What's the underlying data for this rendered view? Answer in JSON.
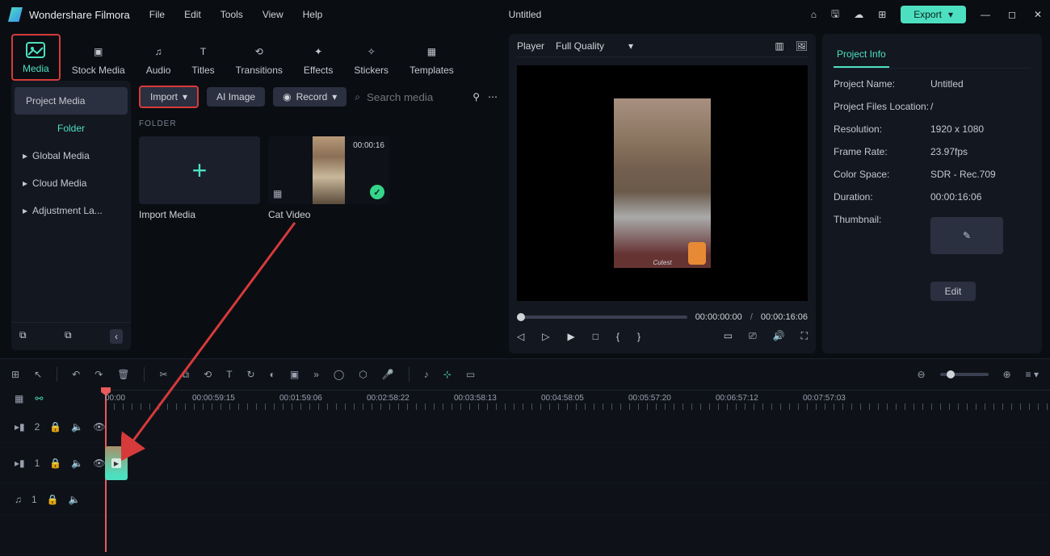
{
  "titlebar": {
    "appname": "Wondershare Filmora",
    "menus": [
      "File",
      "Edit",
      "Tools",
      "View",
      "Help"
    ],
    "doc_title": "Untitled",
    "export": "Export"
  },
  "tabs": [
    {
      "label": "Media"
    },
    {
      "label": "Stock Media"
    },
    {
      "label": "Audio"
    },
    {
      "label": "Titles"
    },
    {
      "label": "Transitions"
    },
    {
      "label": "Effects"
    },
    {
      "label": "Stickers"
    },
    {
      "label": "Templates"
    }
  ],
  "sidebar": {
    "project_media": "Project Media",
    "folder": "Folder",
    "items": [
      "Global Media",
      "Cloud Media",
      "Adjustment La..."
    ]
  },
  "toolbar": {
    "import": "Import",
    "ai_image": "AI Image",
    "record": "Record",
    "search_ph": "Search media"
  },
  "folder_label": "FOLDER",
  "thumbs": {
    "import_media": "Import Media",
    "cat_video": "Cat Video",
    "cat_dur": "00:00:16"
  },
  "preview": {
    "player": "Player",
    "quality": "Full Quality",
    "cutest": "Cutest",
    "current": "00:00:00:00",
    "total": "00:00:16:06"
  },
  "panel": {
    "tab": "Project Info",
    "labels": {
      "name": "Project Name:",
      "loc": "Project Files Location:",
      "res": "Resolution:",
      "fps": "Frame Rate:",
      "cs": "Color Space:",
      "dur": "Duration:",
      "thumb": "Thumbnail:"
    },
    "values": {
      "name": "Untitled",
      "loc": "/",
      "res": "1920 x 1080",
      "fps": "23.97fps",
      "cs": "SDR - Rec.709",
      "dur": "00:00:16:06"
    },
    "edit": "Edit"
  },
  "ruler": [
    "00:00",
    "00:00:59:15",
    "00:01:59:06",
    "00:02:58:22",
    "00:03:58:13",
    "00:04:58:05",
    "00:05:57:20",
    "00:06:57:12",
    "00:07:57:03"
  ],
  "tracks": {
    "v2": "2",
    "v1": "1",
    "a1": "1"
  }
}
